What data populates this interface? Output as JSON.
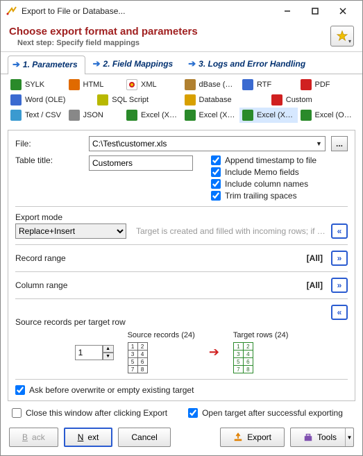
{
  "window": {
    "title": "Export to File or Database..."
  },
  "header": {
    "title": "Choose export format and parameters",
    "sub": "Next step: Specify field mappings"
  },
  "tabs": [
    {
      "label": "1. Parameters"
    },
    {
      "label": "2. Field Mappings"
    },
    {
      "label": "3. Logs and Error Handling"
    }
  ],
  "formats": {
    "row1": [
      {
        "label": "SYLK",
        "bg": "#2a8a2a"
      },
      {
        "label": "HTML",
        "bg": "#e06a00"
      },
      {
        "label": "XML",
        "bg": "#ffffff"
      },
      {
        "label": "dBase (DBF)",
        "bg": "#b08030"
      },
      {
        "label": "RTF",
        "bg": "#3a6ad0"
      },
      {
        "label": "PDF",
        "bg": "#d02020"
      }
    ],
    "row2": [
      {
        "label": "Word (OLE)",
        "bg": "#3a6ad0"
      },
      {
        "label": "SQL Script",
        "bg": "#b8b800"
      },
      {
        "label": "Database",
        "bg": "#d8a000"
      },
      {
        "label": "Custom",
        "bg": "#d02020"
      }
    ],
    "row3": [
      {
        "label": "Text / CSV",
        "bg": "#3a9ad0"
      },
      {
        "label": "JSON",
        "bg": "#888"
      },
      {
        "label": "Excel (XLSX)",
        "bg": "#2a8a2a"
      },
      {
        "label": "Excel (XML)",
        "bg": "#2a8a2a"
      },
      {
        "label": "Excel (XLS)",
        "bg": "#2a8a2a",
        "selected": true
      },
      {
        "label": "Excel (OLE)",
        "bg": "#2a8a2a"
      }
    ]
  },
  "fields": {
    "file_label": "File:",
    "file_value": "C:\\Test\\customer.xls",
    "browse": "...",
    "title_label": "Table title:",
    "title_value": "Customers",
    "cb_timestamp": "Append timestamp to file",
    "cb_memo": "Include Memo fields",
    "cb_cols": "Include column names",
    "cb_trim": "Trim trailing spaces"
  },
  "mode": {
    "label": "Export mode",
    "value": "Replace+Insert",
    "hint": "Target is created and filled with incoming rows; if target..."
  },
  "record_range": {
    "label": "Record range",
    "value": "[All]"
  },
  "column_range": {
    "label": "Column range",
    "value": "[All]"
  },
  "source": {
    "label": "Source records per target row",
    "src_cap": "Source records (24)",
    "tgt_cap": "Target rows (24)",
    "value": "1"
  },
  "ask_overwrite": "Ask before overwrite or empty existing target",
  "close_after": "Close this window after clicking Export",
  "open_after": "Open target after successful exporting",
  "buttons": {
    "back": "Back",
    "next": "Next",
    "cancel": "Cancel",
    "export": "Export",
    "tools": "Tools"
  }
}
